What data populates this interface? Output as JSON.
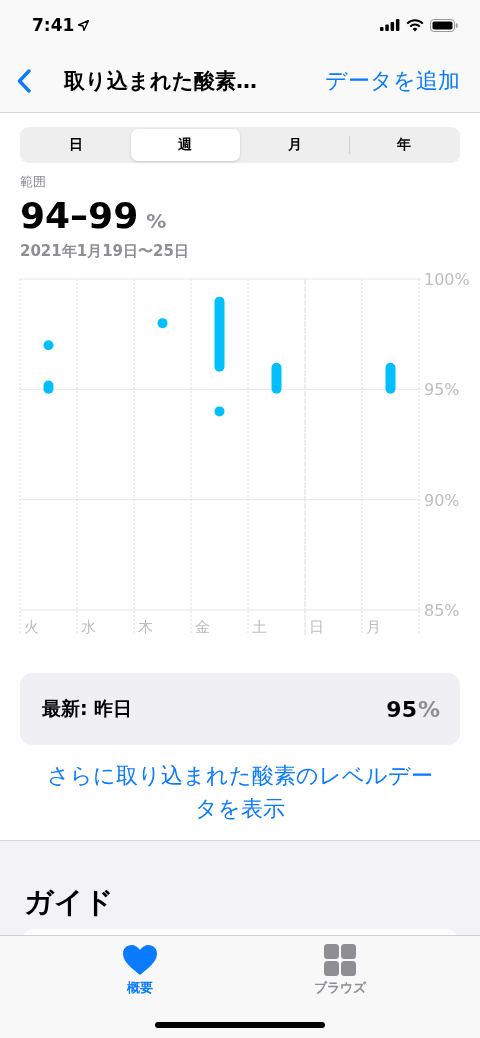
{
  "status_bar": {
    "time": "7:41"
  },
  "nav": {
    "title": "取り込まれた酸素…",
    "action": "データを追加"
  },
  "segments": [
    {
      "label": "日",
      "selected": false
    },
    {
      "label": "週",
      "selected": true
    },
    {
      "label": "月",
      "selected": false
    },
    {
      "label": "年",
      "selected": false
    }
  ],
  "summary": {
    "label": "範囲",
    "value": "94–99",
    "unit": "%",
    "date": "2021年1月19日〜25日"
  },
  "chart": {
    "chart_data": {
      "type": "candlestick",
      "categories": [
        "火",
        "水",
        "木",
        "金",
        "土",
        "日",
        "月"
      ],
      "ylim": [
        85,
        100
      ],
      "yticks": [
        {
          "value": 100,
          "label": "100%"
        },
        {
          "value": 95,
          "label": "95%"
        },
        {
          "value": 90,
          "label": "90%"
        },
        {
          "value": 85,
          "label": "85%"
        }
      ],
      "ohlc": [
        [
          94.8,
          95.4,
          94.8,
          95.4
        ],
        null,
        null,
        [
          95.8,
          99.2,
          95.8,
          99.2
        ],
        [
          94.8,
          96.2,
          94.8,
          96.2
        ],
        null,
        [
          94.8,
          96.2,
          94.8,
          96.2
        ]
      ],
      "series": [
        {
          "type": "scatter",
          "color": "#00bfff",
          "values": [
            97,
            null,
            98,
            94,
            null,
            null,
            null
          ]
        }
      ]
    }
  },
  "latest": {
    "label": "最新: 昨日",
    "value": "95",
    "unit": "%"
  },
  "more_link": "さらに取り込まれた酸素のレベルデータを表示",
  "guide": {
    "title": "ガイド"
  },
  "tab_bar": [
    {
      "label": "概要",
      "selected": true,
      "kind": "heart"
    },
    {
      "label": "ブラウズ",
      "selected": false,
      "kind": "grid"
    }
  ]
}
